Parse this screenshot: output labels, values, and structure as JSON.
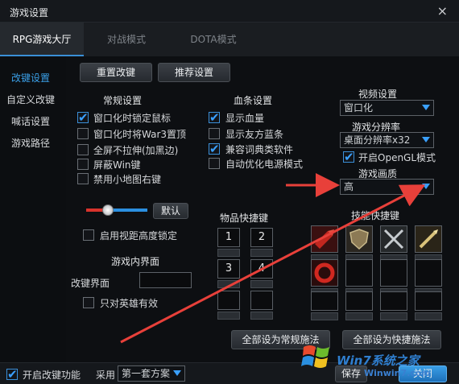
{
  "window": {
    "title": "游戏设置",
    "close_label": "×"
  },
  "tabs": [
    {
      "label": "RPG游戏大厅",
      "active": true
    },
    {
      "label": "对战模式",
      "active": false
    },
    {
      "label": "DOTA模式",
      "active": false
    }
  ],
  "sidebar": {
    "items": [
      {
        "label": "改键设置",
        "active": true
      },
      {
        "label": "自定义改键",
        "active": false
      },
      {
        "label": "喊话设置",
        "active": false
      },
      {
        "label": "游戏路径",
        "active": false
      }
    ]
  },
  "toolbar": {
    "reset_label": "重置改键",
    "recommend_label": "推荐设置"
  },
  "general": {
    "title": "常规设置",
    "options": [
      {
        "label": "窗口化时锁定鼠标",
        "checked": true
      },
      {
        "label": "窗口化时将War3置顶",
        "checked": false
      },
      {
        "label": "全屏不拉伸(加黑边)",
        "checked": false
      },
      {
        "label": "屏蔽Win键",
        "checked": false
      },
      {
        "label": "禁用小地图右键",
        "checked": false
      }
    ]
  },
  "healthbar": {
    "title": "血条设置",
    "options": [
      {
        "label": "显示血量",
        "checked": true
      },
      {
        "label": "显示友方蓝条",
        "checked": false
      },
      {
        "label": "兼容词典类软件",
        "checked": true
      },
      {
        "label": "自动优化电源模式",
        "checked": false
      }
    ]
  },
  "video": {
    "title": "视频设置",
    "mode_value": "窗口化",
    "resolution_title": "游戏分辨率",
    "resolution_value": "桌面分辨率x32",
    "opengl_label": "开启OpenGL模式",
    "opengl_checked": true,
    "quality_title": "游戏画质",
    "quality_value": "高"
  },
  "view": {
    "default_label": "默认",
    "height_lock_label": "启用视距高度锁定",
    "height_lock_checked": false,
    "slider_level_fraction": 0.35
  },
  "ui_section": {
    "title": "游戏内界面",
    "change_ui_label": "改键界面",
    "hero_only_label": "只对英雄有效",
    "hero_only_checked": false
  },
  "item_keys": {
    "title": "物品快捷键",
    "keys": [
      "1",
      "2",
      "3",
      "4",
      "",
      ""
    ]
  },
  "skill_keys": {
    "title": "技能快捷键",
    "icons": [
      "arrow-skill-icon",
      "shield-skill-icon",
      "swords-skill-icon",
      "sword-skill-icon",
      "ring-skill-icon",
      "",
      "",
      "",
      "",
      "",
      "",
      ""
    ]
  },
  "actions": {
    "set_all_normal": "全部设为常规施法",
    "set_all_quick": "全部设为快捷施法"
  },
  "footer": {
    "enable_label": "开启改键功能",
    "enable_checked": true,
    "use_label": "采用",
    "scheme_value": "第一套方案",
    "save_label": "保存",
    "close_label": "关闭",
    "watermark": "Win7系统之家",
    "watermark_url": "Winwin7.com"
  },
  "colors": {
    "accent": "#3a9ee6",
    "arrow": "#e8403a",
    "slider_left": "#d8332c",
    "slider_right": "#2b8fe0"
  }
}
